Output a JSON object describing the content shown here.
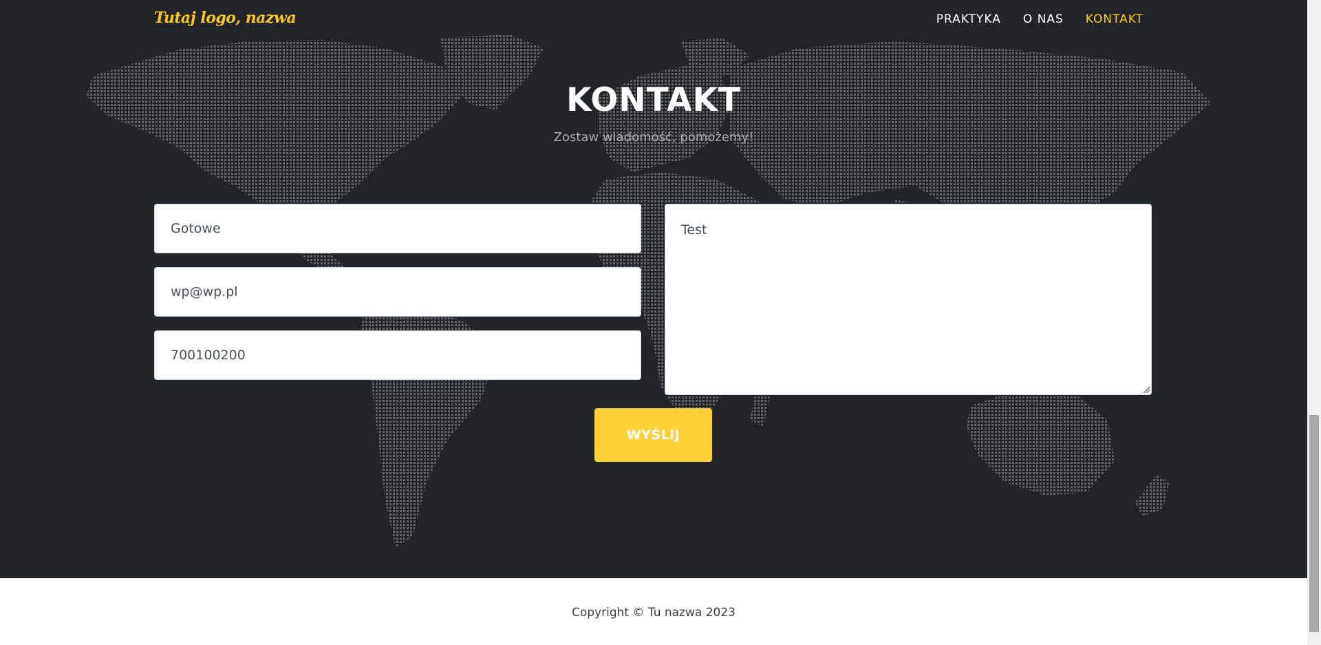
{
  "navbar": {
    "brand": "Tutaj logo, nazwa",
    "links": [
      {
        "label": "PRAKTYKA",
        "active": false
      },
      {
        "label": "O NAS",
        "active": false
      },
      {
        "label": "KONTAKT",
        "active": true
      }
    ]
  },
  "contact": {
    "title": "KONTAKT",
    "subtitle": "Zostaw wiadomość, pomożemy!",
    "form": {
      "name_value": "Gotowe",
      "email_value": "wp@wp.pl",
      "phone_value": "700100200",
      "message_value": "Test",
      "submit_label": "WYŚLIJ"
    }
  },
  "footer": {
    "copyright": "Copyright © Tu nazwa 2023"
  },
  "colors": {
    "accent": "#fed136",
    "brand": "#fec810",
    "background": "#212529"
  }
}
